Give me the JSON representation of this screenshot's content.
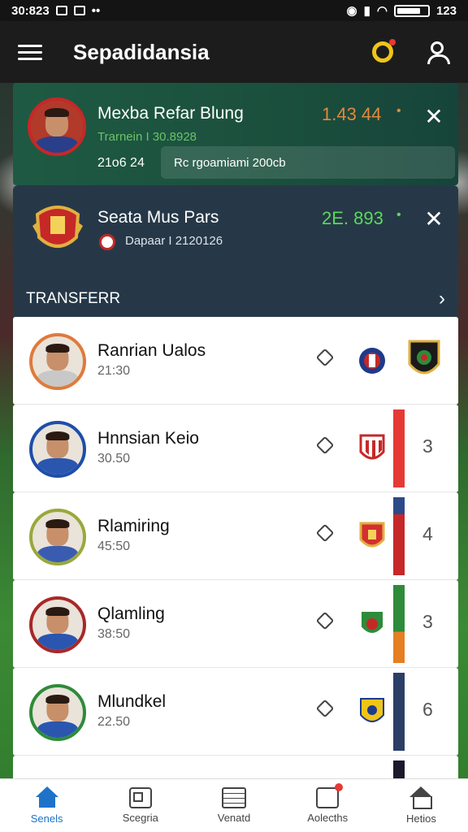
{
  "status_bar": {
    "time": "30:823",
    "battery": "123"
  },
  "app_bar": {
    "title": "Sepadidansia"
  },
  "live_cards": [
    {
      "name": "Mexba Refar Blung",
      "subtitle": "Trarnein I 30.8928",
      "score": "1.43 44",
      "dot": "•",
      "time": "21o6 24",
      "pill_text": "Rc rgoamiami 200cb",
      "close": "✕"
    },
    {
      "name": "Seata Mus Pars",
      "subtitle": "Dapaar I 2120126",
      "score": "2E. 893",
      "dot": "•",
      "close": "✕"
    }
  ],
  "section": {
    "title": "TRANSFERR",
    "chevron": "›"
  },
  "players": [
    {
      "name": "Ranrian Ualos",
      "time": "21:30",
      "ring": "#e07a3a",
      "shirt": "#c8c8c8",
      "crest": "#c62828",
      "extra_crest": true,
      "number": ""
    },
    {
      "name": "Hnnsian Keio",
      "time": "30.50",
      "ring": "#1e4ea8",
      "shirt": "#2a56b0",
      "crest": "#c62828",
      "bar_top": "#e53935",
      "bar_bottom": "#e53935",
      "number": "3"
    },
    {
      "name": "Rlamiring",
      "time": "45:50",
      "ring": "#9aa83a",
      "shirt": "#3a5cb0",
      "crest": "#d32f2f",
      "bar_top": "#2b4a8a",
      "bar_bottom": "#c62828",
      "number": "4"
    },
    {
      "name": "Qlamling",
      "time": "38:50",
      "ring": "#a82828",
      "shirt": "#2a56b0",
      "crest": "#2e8b3a",
      "bar_top": "#2e8b3a",
      "bar_bottom": "#e67e22",
      "number": "3"
    },
    {
      "name": "Mlundkel",
      "time": "22.50",
      "ring": "#2e8b3a",
      "shirt": "#2a56b0",
      "crest": "#f0c419",
      "bar_top": "#2b3f66",
      "bar_bottom": "#2b3f66",
      "number": "6"
    }
  ],
  "bottom_nav": [
    {
      "label": "Senels",
      "icon": "home-icon",
      "active": true
    },
    {
      "label": "Scegria",
      "icon": "grid-icon",
      "active": false
    },
    {
      "label": "Venatd",
      "icon": "list-icon",
      "active": false
    },
    {
      "label": "Aolecths",
      "icon": "notification-icon",
      "active": false
    },
    {
      "label": "Hetios",
      "icon": "home-outline-icon",
      "active": false
    }
  ]
}
